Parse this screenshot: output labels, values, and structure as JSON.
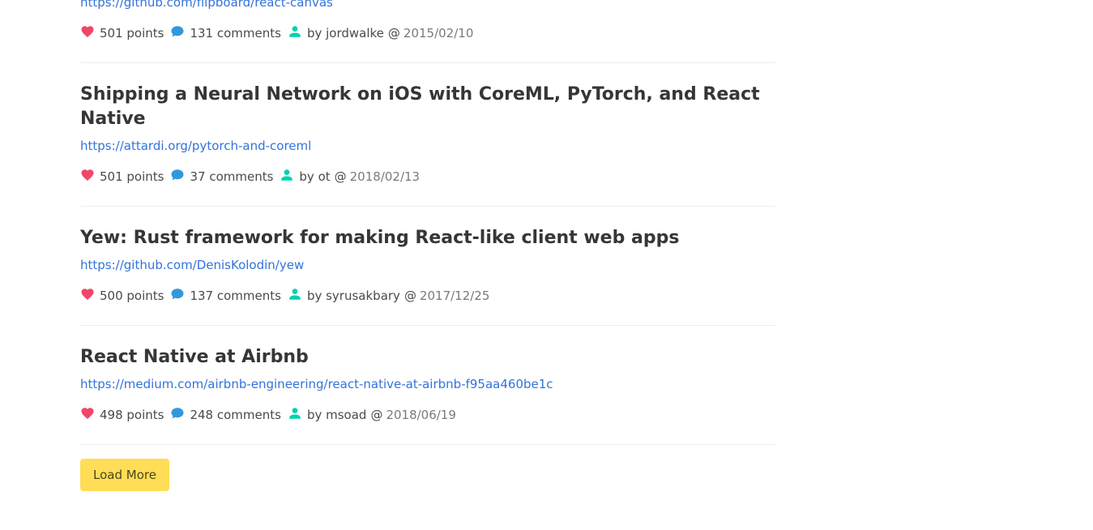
{
  "colors": {
    "heart": "#f14668",
    "comment": "#3298dc",
    "user": "#00d1b2",
    "link": "#3273dc",
    "button": "#ffdd57"
  },
  "stories": [
    {
      "title": "",
      "url": "https://github.com/flipboard/react-canvas",
      "points": "501 points",
      "comments": "131 comments",
      "author": "by jordwalke",
      "at": "@",
      "date": "2015/02/10"
    },
    {
      "title": "Shipping a Neural Network on iOS with CoreML, PyTorch, and React Native",
      "url": "https://attardi.org/pytorch-and-coreml",
      "points": "501 points",
      "comments": "37 comments",
      "author": "by ot",
      "at": "@",
      "date": "2018/02/13"
    },
    {
      "title": "Yew: Rust framework for making React-like client web apps",
      "url": "https://github.com/DenisKolodin/yew",
      "points": "500 points",
      "comments": "137 comments",
      "author": "by syrusakbary",
      "at": "@",
      "date": "2017/12/25"
    },
    {
      "title": "React Native at Airbnb",
      "url": "https://medium.com/airbnb-engineering/react-native-at-airbnb-f95aa460be1c",
      "points": "498 points",
      "comments": "248 comments",
      "author": "by msoad",
      "at": "@",
      "date": "2018/06/19"
    }
  ],
  "load_more_label": "Load More"
}
